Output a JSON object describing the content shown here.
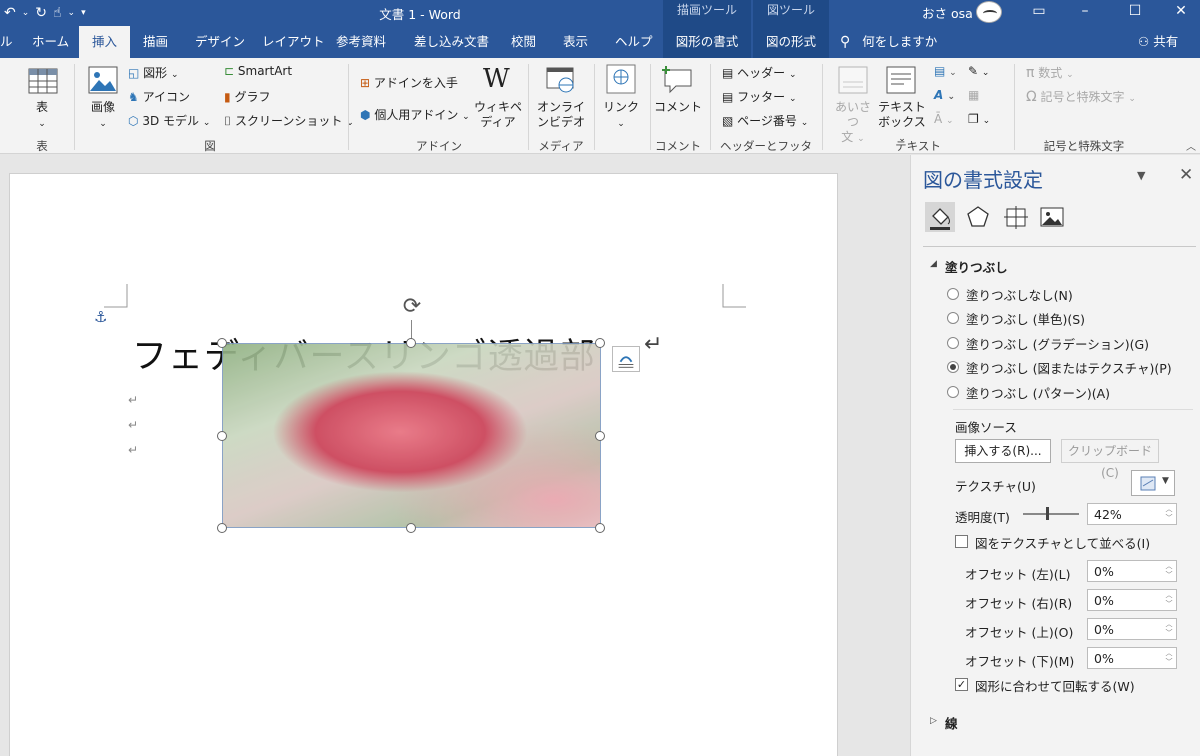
{
  "window": {
    "title": "文書 1  -  Word",
    "user": "おさ osa",
    "context_tabs": [
      "描画ツール",
      "図ツール"
    ]
  },
  "tabs": [
    {
      "label": "ル"
    },
    {
      "label": "ホーム"
    },
    {
      "label": "挿入"
    },
    {
      "label": "描画"
    },
    {
      "label": "デザイン"
    },
    {
      "label": "レイアウト"
    },
    {
      "label": "参考資料"
    },
    {
      "label": "差し込み文書"
    },
    {
      "label": "校閲"
    },
    {
      "label": "表示"
    },
    {
      "label": "ヘルプ"
    },
    {
      "label": "図形の書式"
    },
    {
      "label": "図の形式"
    }
  ],
  "tell_me": "何をしますか",
  "share": "共有",
  "ribbon": {
    "table": {
      "button": "表",
      "group": "表"
    },
    "illustrations": {
      "image": "画像",
      "shapes": "図形",
      "icons": "アイコン",
      "models3d": "3D モデル",
      "smartart": "SmartArt",
      "chart": "グラフ",
      "screenshot": "スクリーンショット",
      "group": "図"
    },
    "addins": {
      "get": "アドインを入手",
      "personal": "個人用アドイン",
      "wiki_line1": "ウィキペ",
      "wiki_line2": "ディア",
      "group": "アドイン"
    },
    "media": {
      "line1": "オンライ",
      "line2": "ンビデオ",
      "group": "メディア"
    },
    "link": {
      "label": "リンク"
    },
    "comment": {
      "label": "コメント",
      "group": "コメント"
    },
    "header_footer": {
      "header": "ヘッダー",
      "footer": "フッター",
      "page_number": "ページ番号",
      "group": "ヘッダーとフッター"
    },
    "text": {
      "greeting_line1": "あいさつ",
      "greeting_line2": "文",
      "textbox_line1": "テキスト",
      "textbox_line2": "ボックス",
      "group": "テキスト"
    },
    "symbols": {
      "equation": "数式",
      "symbol": "記号と特殊文字",
      "group": "記号と特殊文字"
    }
  },
  "document": {
    "heading": "フェディバースリンゴ透過部"
  },
  "panel": {
    "title": "図の書式設定",
    "section": "塗りつぶし",
    "fill_options": [
      {
        "label": "塗りつぶしなし(N)",
        "selected": false
      },
      {
        "label": "塗りつぶし (単色)(S)",
        "selected": false
      },
      {
        "label": "塗りつぶし (グラデーション)(G)",
        "selected": false
      },
      {
        "label": "塗りつぶし (図またはテクスチャ)(P)",
        "selected": true
      },
      {
        "label": "塗りつぶし (パターン)(A)",
        "selected": false
      }
    ],
    "image_source": "画像ソース",
    "insert_button": "挿入する(R)...",
    "clipboard_button": "クリップボード(C)",
    "texture": "テクスチャ(U)",
    "transparency_label": "透明度(T)",
    "transparency_value": "42%",
    "transparency": 0.42,
    "tile_label": "図をテクスチャとして並べる(I)",
    "tile_checked": false,
    "offsets": [
      {
        "label": "オフセット (左)(L)",
        "value": "0%"
      },
      {
        "label": "オフセット (右)(R)",
        "value": "0%"
      },
      {
        "label": "オフセット (上)(O)",
        "value": "0%"
      },
      {
        "label": "オフセット (下)(M)",
        "value": "0%"
      }
    ],
    "rotate_label": "図形に合わせて回転する(W)",
    "rotate_checked": true,
    "line_section": "線"
  }
}
